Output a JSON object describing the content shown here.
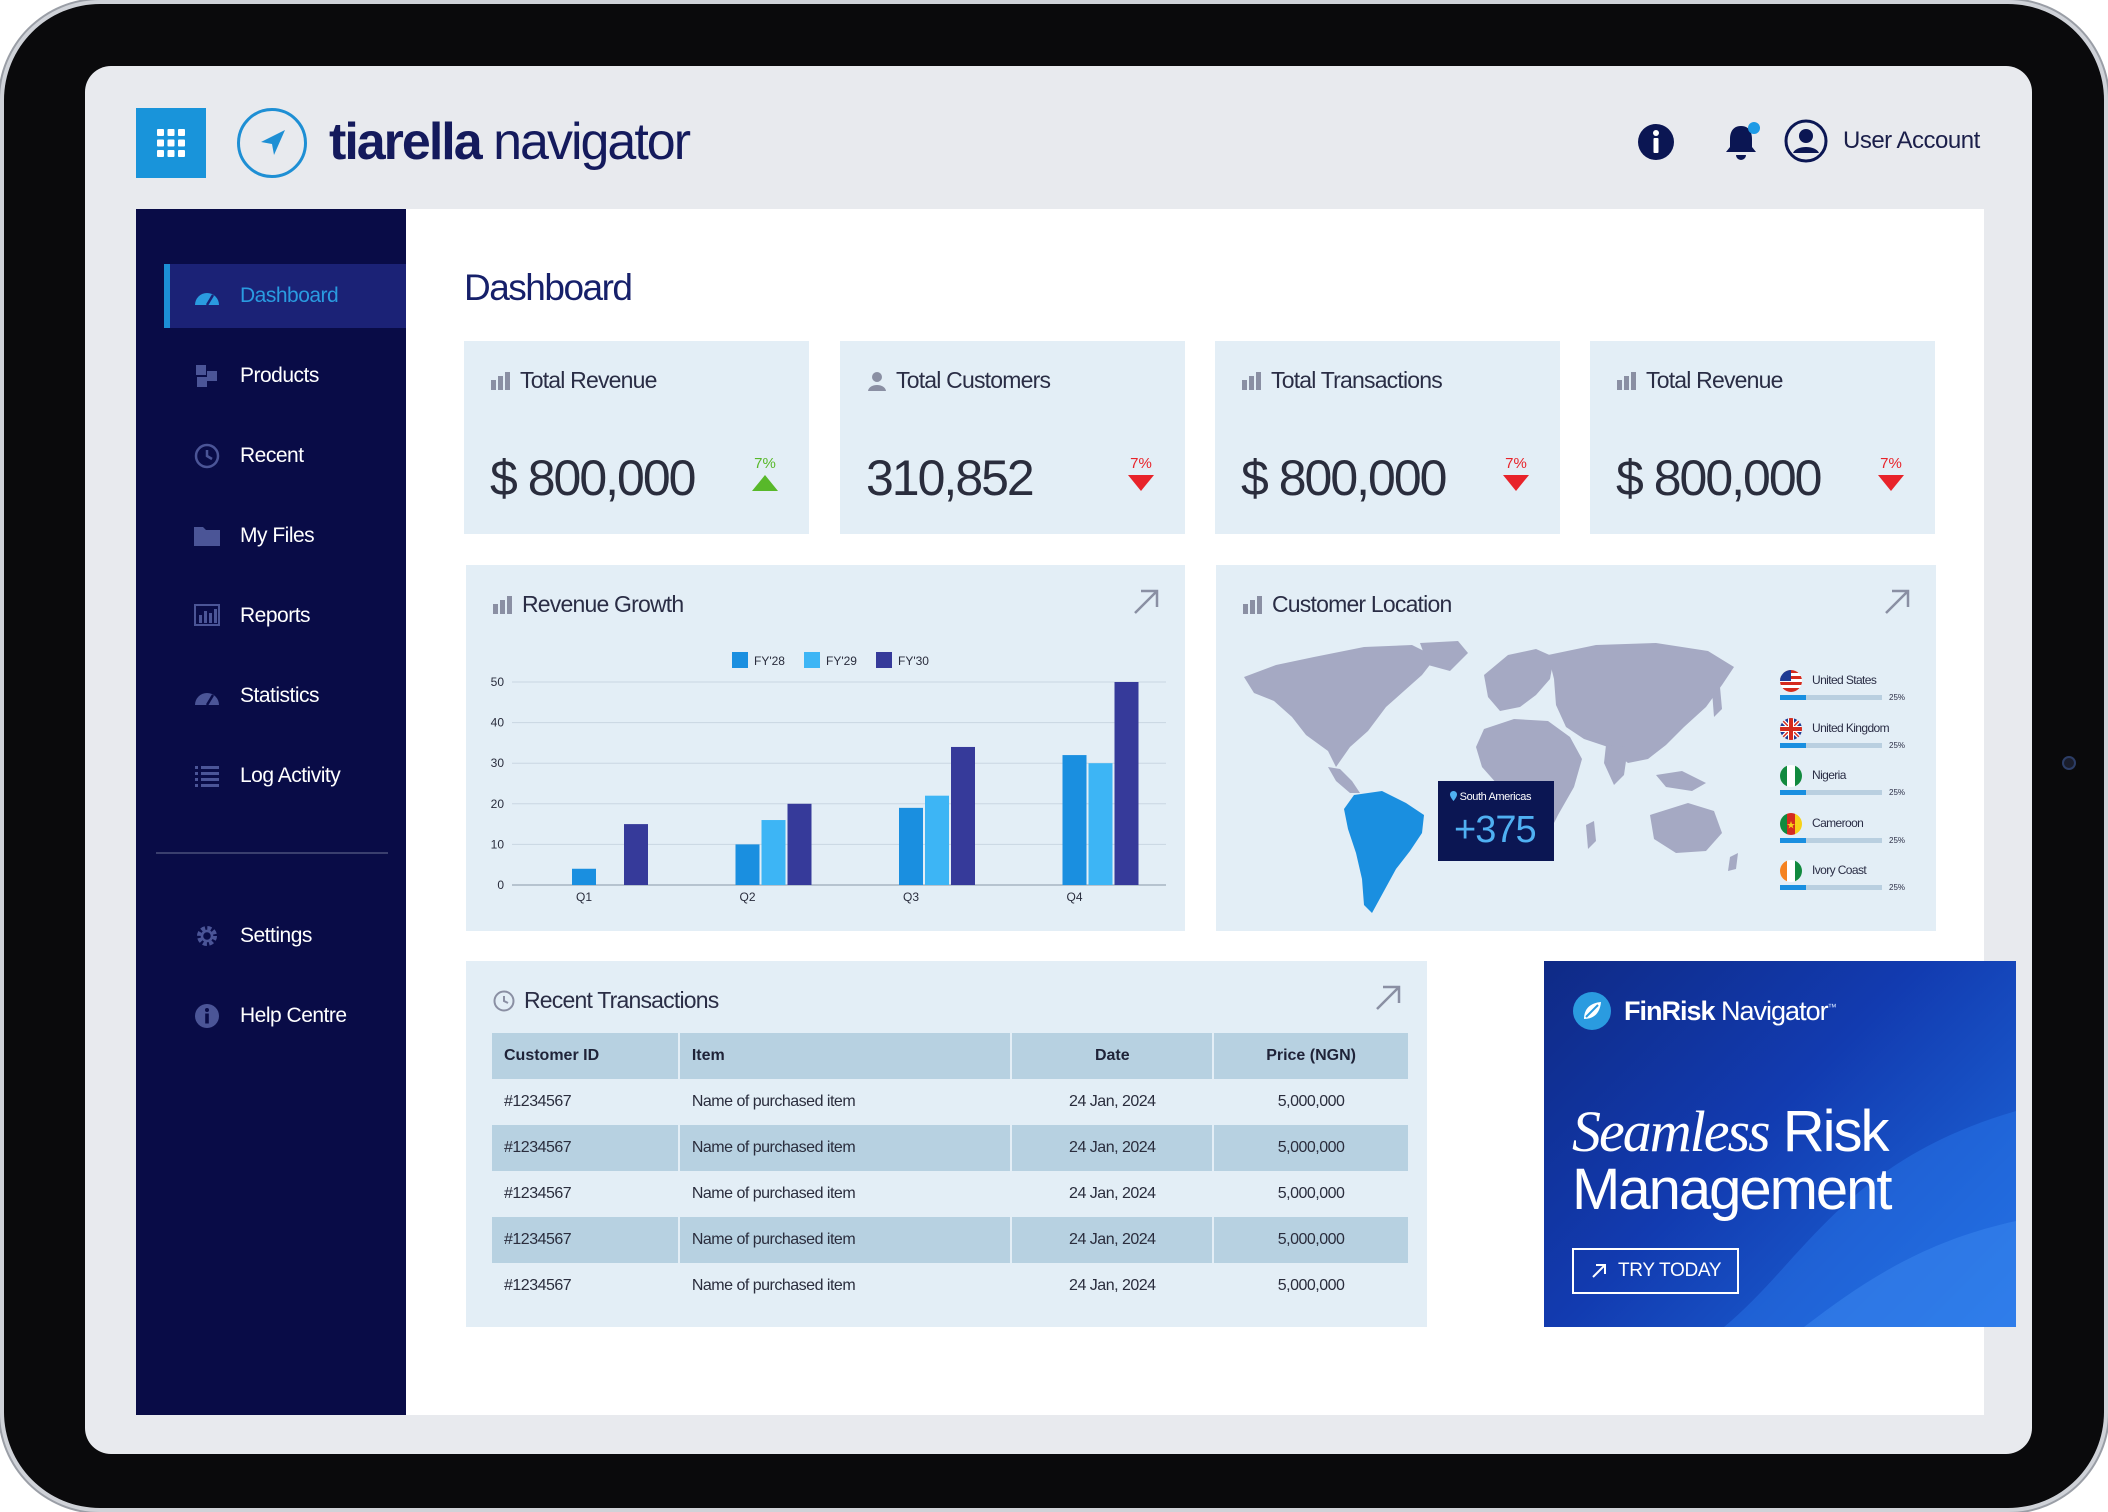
{
  "brand": {
    "bold": "tiarella",
    "light": " navigator"
  },
  "topbar": {
    "user_label": "User Account"
  },
  "sidebar": {
    "items": [
      {
        "label": "Dashboard"
      },
      {
        "label": "Products"
      },
      {
        "label": "Recent"
      },
      {
        "label": "My Files"
      },
      {
        "label": "Reports"
      },
      {
        "label": "Statistics"
      },
      {
        "label": "Log Activity"
      }
    ],
    "bottom_items": [
      {
        "label": "Settings"
      },
      {
        "label": "Help Centre"
      }
    ]
  },
  "page": {
    "title": "Dashboard"
  },
  "kpis": [
    {
      "title": "Total Revenue",
      "value": "$ 800,000",
      "change": "7%",
      "direction": "up",
      "color": "#58b82a"
    },
    {
      "title": "Total Customers",
      "value": "310,852",
      "change": "7%",
      "direction": "down",
      "color": "#e8232a"
    },
    {
      "title": "Total Transactions",
      "value": "$ 800,000",
      "change": "7%",
      "direction": "down",
      "color": "#e8232a"
    },
    {
      "title": "Total Revenue",
      "value": "$ 800,000",
      "change": "7%",
      "direction": "down",
      "color": "#e8232a"
    }
  ],
  "revenue_panel": {
    "title": "Revenue Growth"
  },
  "chart_data": {
    "type": "bar",
    "categories": [
      "Q1",
      "Q2",
      "Q3",
      "Q4"
    ],
    "series": [
      {
        "name": "FY'28",
        "values": [
          4,
          10,
          19,
          32
        ],
        "color": "#1a8fe0"
      },
      {
        "name": "FY'29",
        "values": [
          0,
          16,
          22,
          30
        ],
        "color": "#3db5f5"
      },
      {
        "name": "FY'30",
        "values": [
          15,
          20,
          34,
          50
        ],
        "color": "#363a9a"
      }
    ],
    "yticks": [
      "0",
      "10",
      "20",
      "30",
      "40",
      "50"
    ],
    "ylim": [
      0,
      50
    ],
    "grid": true,
    "legend_position": "top-center"
  },
  "location_panel": {
    "title": "Customer Location",
    "highlight_label": "South Americas",
    "highlight_value": "+375",
    "countries": [
      {
        "name": "United States",
        "percent_label": "25%",
        "share": 0.25,
        "flag": "us"
      },
      {
        "name": "United Kingdom",
        "percent_label": "25%",
        "share": 0.25,
        "flag": "uk"
      },
      {
        "name": "Nigeria",
        "percent_label": "25%",
        "share": 0.25,
        "flag": "ng"
      },
      {
        "name": "Cameroon",
        "percent_label": "25%",
        "share": 0.25,
        "flag": "cm"
      },
      {
        "name": "Ivory Coast",
        "percent_label": "25%",
        "share": 0.25,
        "flag": "ci"
      }
    ]
  },
  "transactions": {
    "title": "Recent Transactions",
    "columns": [
      "Customer ID",
      "Item",
      "Date",
      "Price (NGN)"
    ],
    "rows": [
      [
        "#1234567",
        "Name of purchased item",
        "24 Jan, 2024",
        "5,000,000"
      ],
      [
        "#1234567",
        "Name of purchased item",
        "24 Jan, 2024",
        "5,000,000"
      ],
      [
        "#1234567",
        "Name of purchased item",
        "24 Jan, 2024",
        "5,000,000"
      ],
      [
        "#1234567",
        "Name of purchased item",
        "24 Jan, 2024",
        "5,000,000"
      ],
      [
        "#1234567",
        "Name of purchased item",
        "24 Jan, 2024",
        "5,000,000"
      ]
    ]
  },
  "ad": {
    "brand_bold": "FinRisk",
    "brand_light": " Navigator",
    "trademark": "™",
    "headline_italic": "Seamless",
    "headline_rest_1": " Risk",
    "headline_line2": "Management",
    "cta": "TRY TODAY"
  },
  "colors": {
    "accent": "#1994da",
    "sidebar": "#090c47",
    "panel": "#e3eef6"
  }
}
